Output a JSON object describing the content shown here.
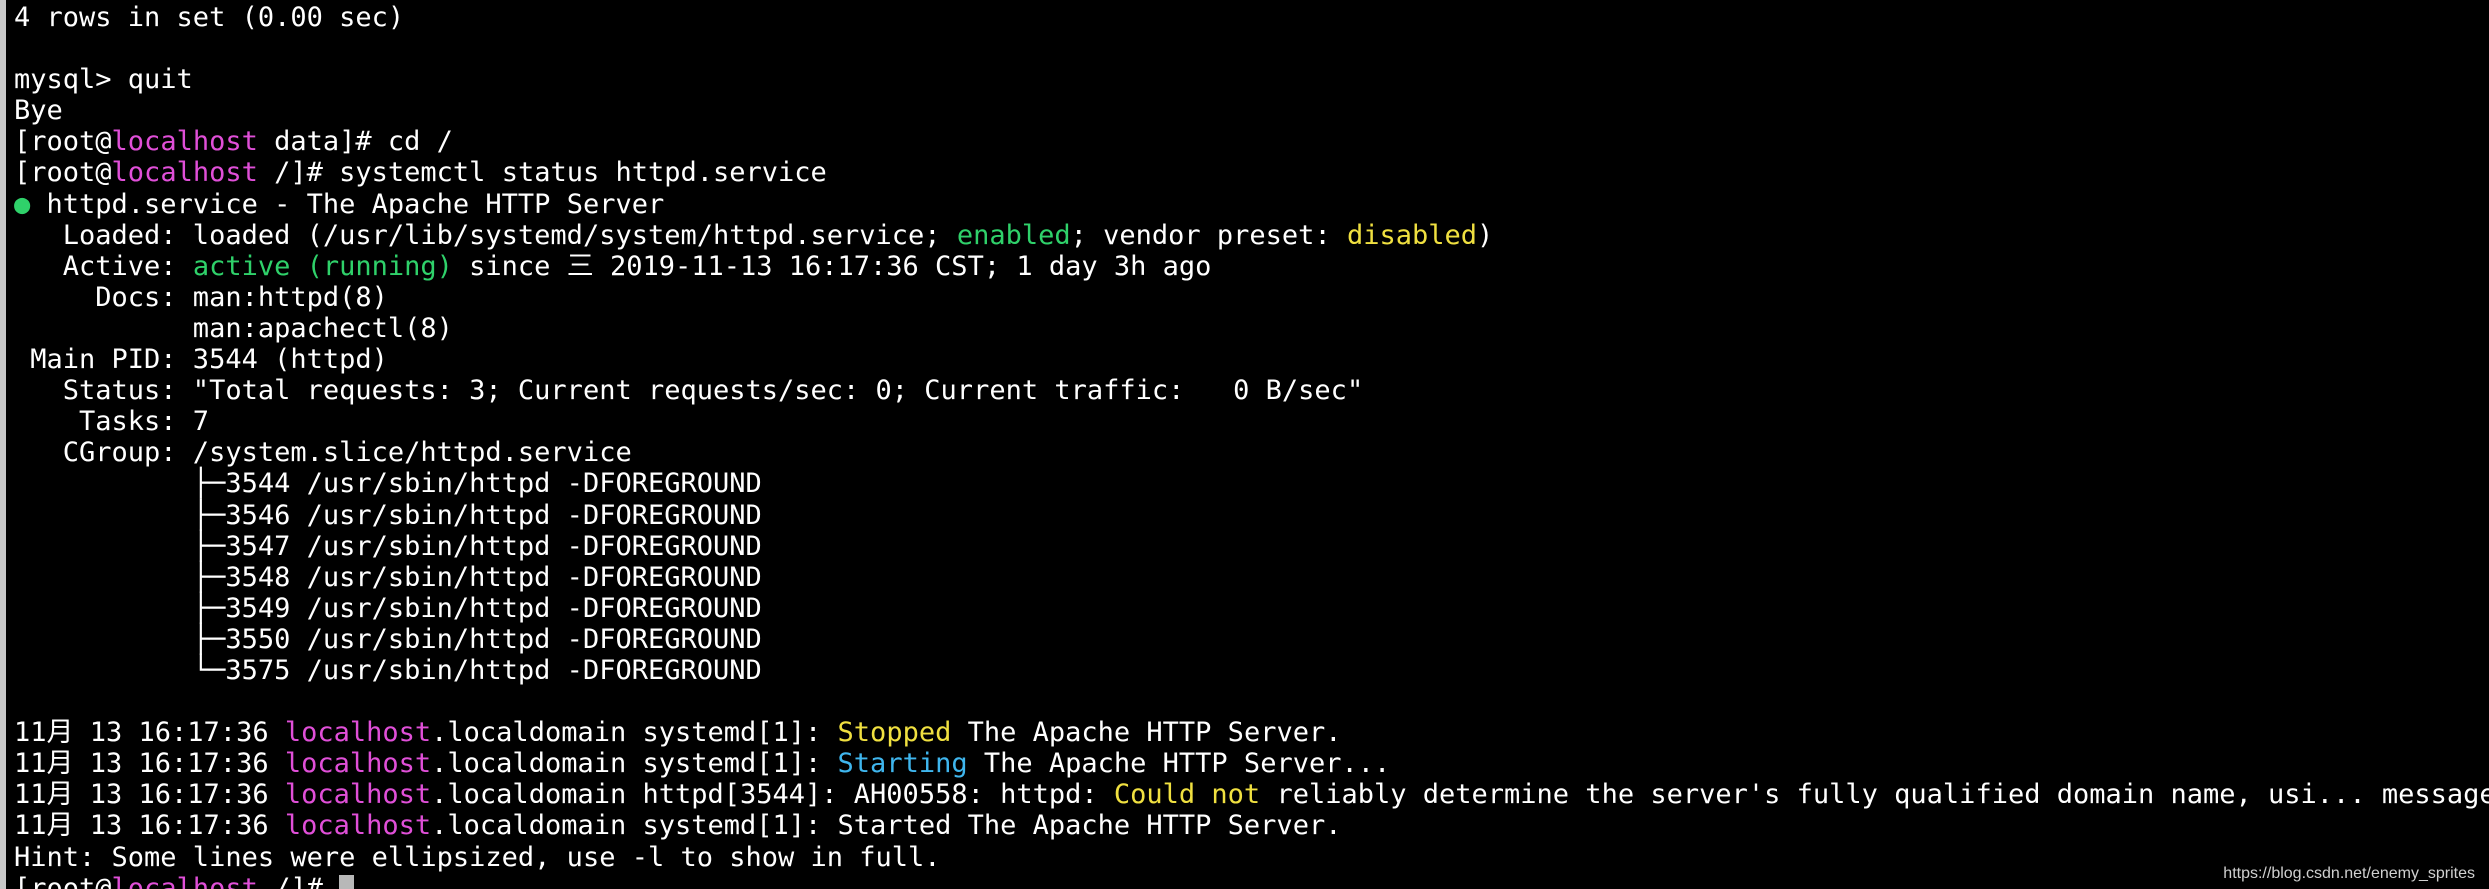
{
  "terminal": {
    "colors": {
      "background": "#000000",
      "foreground": "#ffffff",
      "magenta": "#e04fd8",
      "green": "#2fd16a",
      "yellow": "#f0e040",
      "cyan": "#3fb6ee",
      "cursor": "#b8b8b8"
    },
    "lines": [
      [
        {
          "t": "4 rows in set (0.00 sec)"
        }
      ],
      [
        {
          "t": ""
        }
      ],
      [
        {
          "t": "mysql> quit"
        }
      ],
      [
        {
          "t": "Bye"
        }
      ],
      [
        {
          "t": "[root@"
        },
        {
          "t": "localhost",
          "c": "magenta"
        },
        {
          "t": " data]# cd /"
        }
      ],
      [
        {
          "t": "[root@"
        },
        {
          "t": "localhost",
          "c": "magenta"
        },
        {
          "t": " /]# systemctl status httpd.service"
        }
      ],
      [
        {
          "t": "●",
          "c": "green"
        },
        {
          "t": " httpd.service - The Apache HTTP Server"
        }
      ],
      [
        {
          "t": "   Loaded: loaded (/usr/lib/systemd/system/httpd.service; "
        },
        {
          "t": "enabled",
          "c": "green"
        },
        {
          "t": "; vendor preset: "
        },
        {
          "t": "disabled",
          "c": "yellow"
        },
        {
          "t": ")"
        }
      ],
      [
        {
          "t": "   Active: "
        },
        {
          "t": "active (running)",
          "c": "green"
        },
        {
          "t": " since 三 2019-11-13 16:17:36 CST; 1 day 3h ago"
        }
      ],
      [
        {
          "t": "     Docs: man:httpd(8)"
        }
      ],
      [
        {
          "t": "           man:apachectl(8)"
        }
      ],
      [
        {
          "t": " Main PID: 3544 (httpd)"
        }
      ],
      [
        {
          "t": "   Status: \"Total requests: 3; Current requests/sec: 0; Current traffic:   0 B/sec\""
        }
      ],
      [
        {
          "t": "    Tasks: 7"
        }
      ],
      [
        {
          "t": "   CGroup: /system.slice/httpd.service"
        }
      ],
      [
        {
          "t": "           ├─3544 /usr/sbin/httpd -DFOREGROUND"
        }
      ],
      [
        {
          "t": "           ├─3546 /usr/sbin/httpd -DFOREGROUND"
        }
      ],
      [
        {
          "t": "           ├─3547 /usr/sbin/httpd -DFOREGROUND"
        }
      ],
      [
        {
          "t": "           ├─3548 /usr/sbin/httpd -DFOREGROUND"
        }
      ],
      [
        {
          "t": "           ├─3549 /usr/sbin/httpd -DFOREGROUND"
        }
      ],
      [
        {
          "t": "           ├─3550 /usr/sbin/httpd -DFOREGROUND"
        }
      ],
      [
        {
          "t": "           └─3575 /usr/sbin/httpd -DFOREGROUND"
        }
      ],
      [
        {
          "t": ""
        }
      ],
      [
        {
          "t": "11月 13 16:17:36 "
        },
        {
          "t": "localhost",
          "c": "magenta"
        },
        {
          "t": ".localdomain systemd[1]: "
        },
        {
          "t": "Stopped",
          "c": "yellow"
        },
        {
          "t": " The Apache HTTP Server."
        }
      ],
      [
        {
          "t": "11月 13 16:17:36 "
        },
        {
          "t": "localhost",
          "c": "magenta"
        },
        {
          "t": ".localdomain systemd[1]: "
        },
        {
          "t": "Starting",
          "c": "cyan"
        },
        {
          "t": " The Apache HTTP Server..."
        }
      ],
      [
        {
          "t": "11月 13 16:17:36 "
        },
        {
          "t": "localhost",
          "c": "magenta"
        },
        {
          "t": ".localdomain httpd[3544]: AH00558: httpd: "
        },
        {
          "t": "Could not",
          "c": "yellow"
        },
        {
          "t": " reliably determine the server's fully qualified domain name, usi... message"
        }
      ],
      [
        {
          "t": "11月 13 16:17:36 "
        },
        {
          "t": "localhost",
          "c": "magenta"
        },
        {
          "t": ".localdomain systemd[1]: Started The Apache HTTP Server."
        }
      ],
      [
        {
          "t": "Hint: Some lines were ellipsized, use -l to show in full."
        }
      ],
      [
        {
          "t": "[root@"
        },
        {
          "t": "localhost",
          "c": "magenta"
        },
        {
          "t": " /]# "
        },
        {
          "cursor": true
        }
      ]
    ]
  },
  "watermark": "https://blog.csdn.net/enemy_sprites"
}
